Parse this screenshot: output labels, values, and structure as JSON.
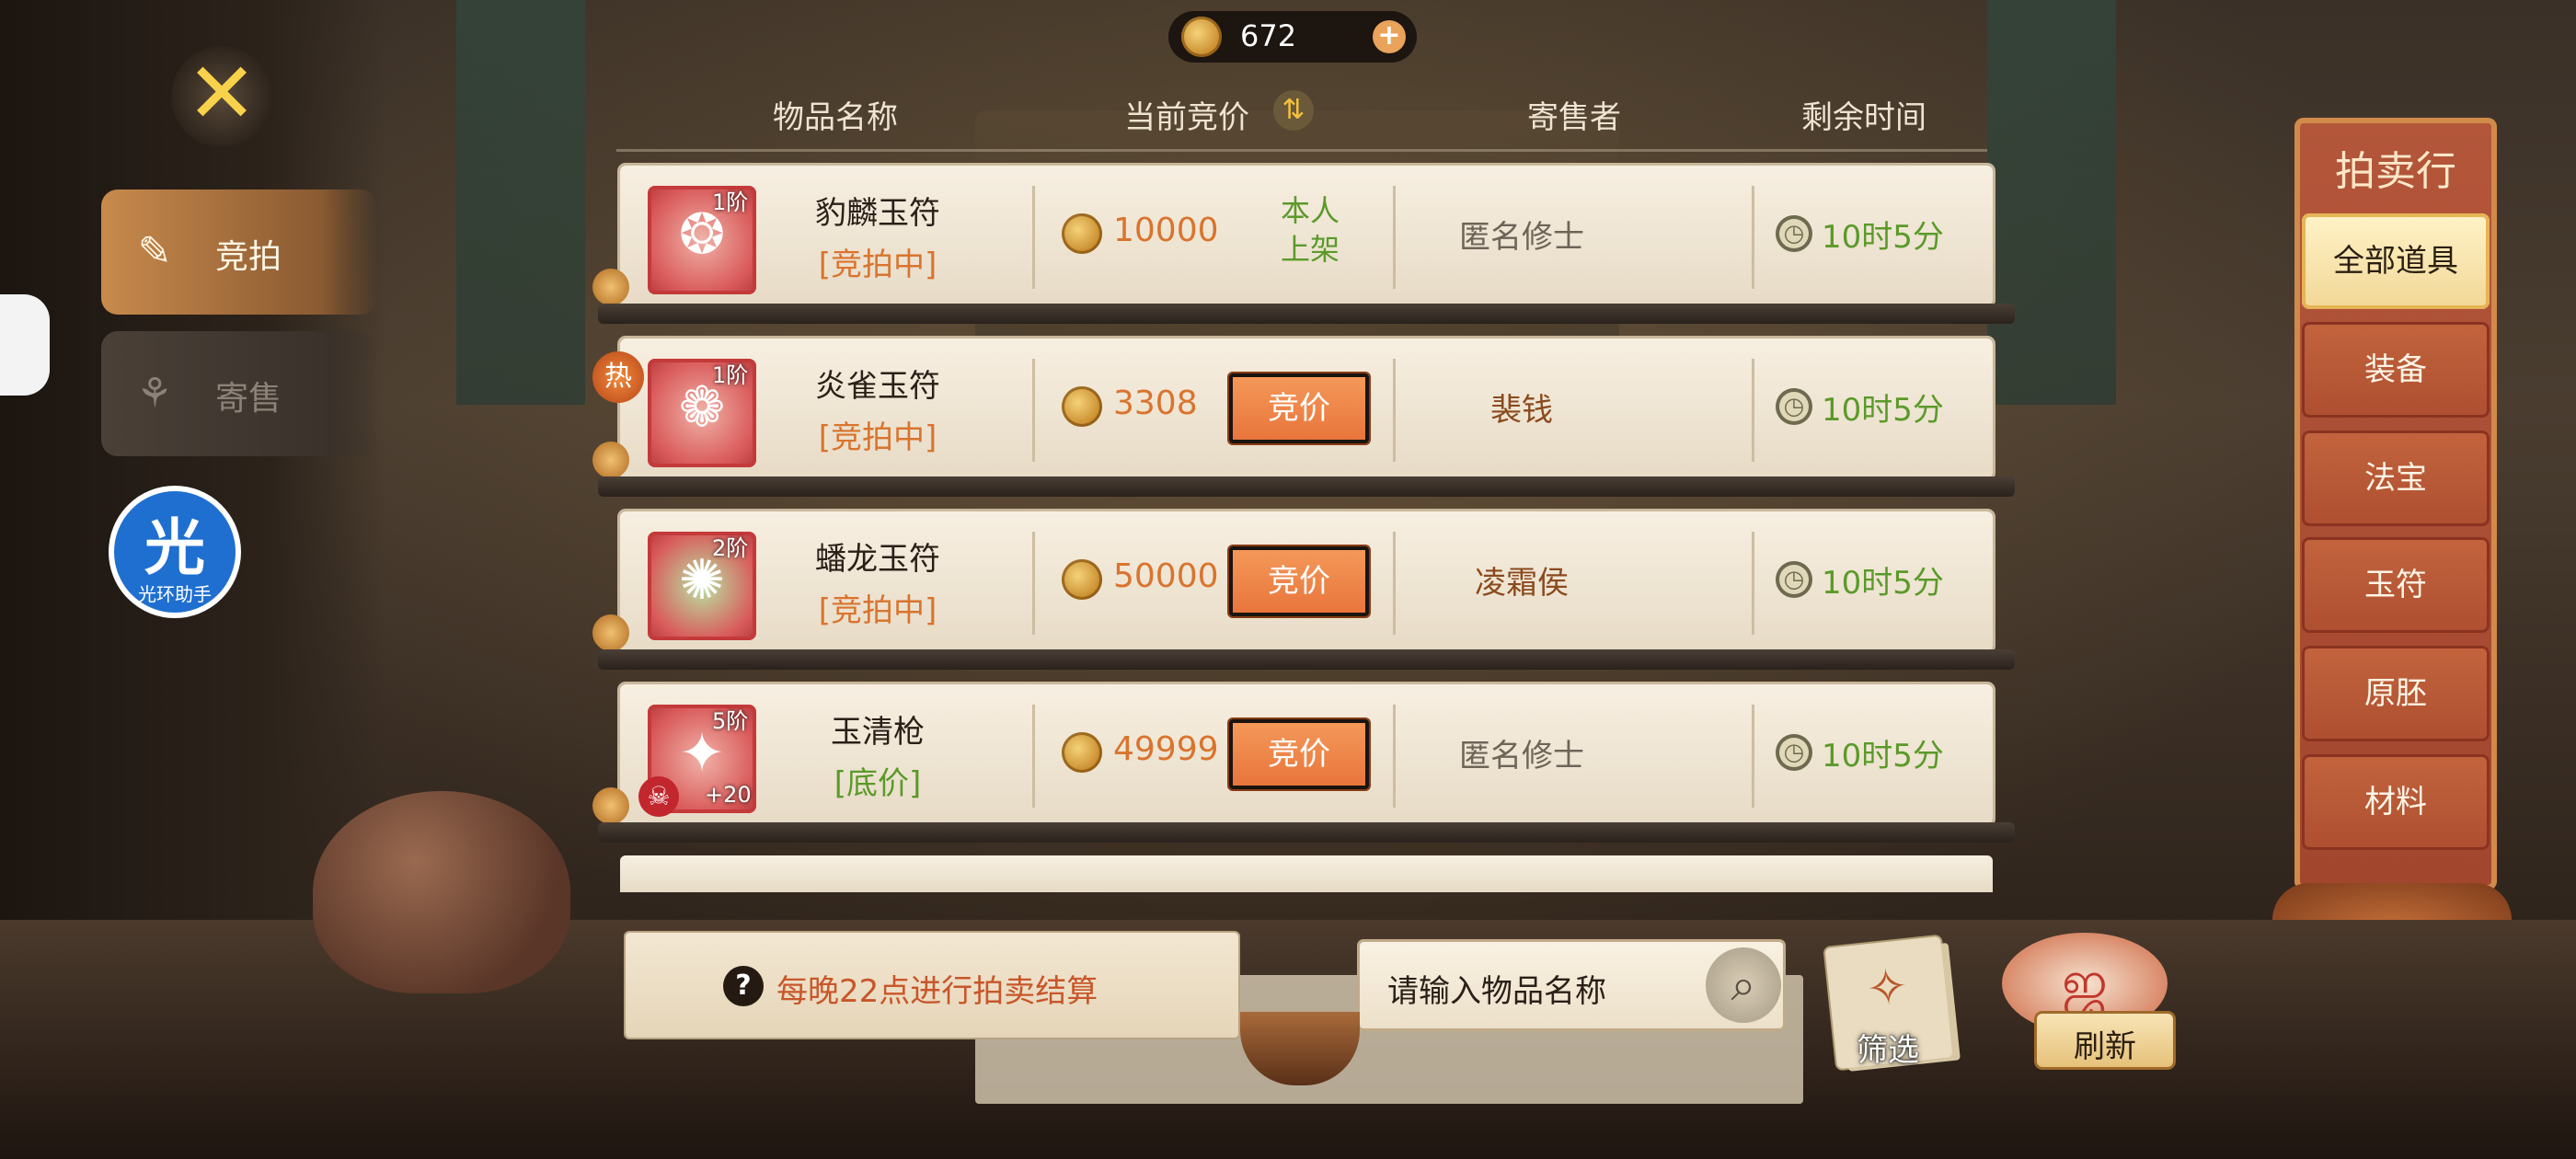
{
  "currency": {
    "amount": "672",
    "icon": "coin-icon",
    "plus_icon": "plus-icon"
  },
  "close_icon": "close-icon",
  "left_tabs": [
    {
      "label": "竞拍",
      "icon": "auction-icon",
      "active": true
    },
    {
      "label": "寄售",
      "icon": "consign-icon",
      "active": false
    }
  ],
  "helper": {
    "big": "光",
    "small": "光环助手"
  },
  "columns": {
    "name": "物品名称",
    "price": "当前竞价",
    "seller": "寄售者",
    "time": "剩余时间",
    "sort_icon": "sort-icon"
  },
  "rows": [
    {
      "tier": "1阶",
      "name": "豹麟玉符",
      "status": "[竞拍中]",
      "price": "10000",
      "action": "本人上架",
      "own_line1": "本人",
      "own_line2": "上架",
      "seller": "匿名修士",
      "time": "10时5分",
      "hot": false,
      "glyph": "❂"
    },
    {
      "tier": "1阶",
      "name": "炎雀玉符",
      "status": "[竞拍中]",
      "price": "3308",
      "action": "竞价",
      "seller": "裴钱",
      "time": "10时5分",
      "hot": true,
      "hot_label": "热",
      "glyph": "❁"
    },
    {
      "tier": "2阶",
      "name": "蟠龙玉符",
      "status": "[竞拍中]",
      "price": "50000",
      "action": "竞价",
      "seller": "凌霜侯",
      "time": "10时5分",
      "hot": false,
      "glyph": "✺"
    },
    {
      "tier": "5阶",
      "name": "玉清枪",
      "status": "[底价]",
      "price": "49999",
      "action": "竞价",
      "seller": "匿名修士",
      "time": "10时5分",
      "hot": false,
      "plus": "+20",
      "skull_icon": "skull-icon",
      "glyph": "✦"
    }
  ],
  "right_panel": {
    "title": "拍卖行",
    "categories": [
      "全部道具",
      "装备",
      "法宝",
      "玉符",
      "原胚",
      "材料"
    ],
    "active_index": 0
  },
  "notice": {
    "text": "每晚22点进行拍卖结算",
    "icon": "question-icon"
  },
  "search": {
    "placeholder": "请输入物品名称",
    "icon": "search-icon"
  },
  "filter": {
    "label": "筛选",
    "icon": "filter-icon"
  },
  "refresh": {
    "label": "刷新",
    "icon": "refresh-icon"
  },
  "colors": {
    "accent_orange": "#d9742e",
    "green": "#5b9a2a",
    "bid_button": "#f08a4a",
    "panel_red": "#b3563a"
  }
}
